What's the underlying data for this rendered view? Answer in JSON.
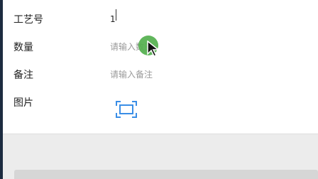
{
  "form": {
    "rows": [
      {
        "label": "工艺号",
        "value": "1",
        "placeholder": ""
      },
      {
        "label": "数量",
        "value": "",
        "placeholder": "请输入数量"
      },
      {
        "label": "备注",
        "value": "",
        "placeholder": "请输入备注"
      },
      {
        "label": "图片"
      }
    ]
  },
  "icons": {
    "camera": "scan-frame-icon",
    "pointer": "mouse-pointer-icon"
  },
  "colors": {
    "accent": "#3a8ee6",
    "touch": "#54b04e",
    "edge": "#1c2b40"
  }
}
